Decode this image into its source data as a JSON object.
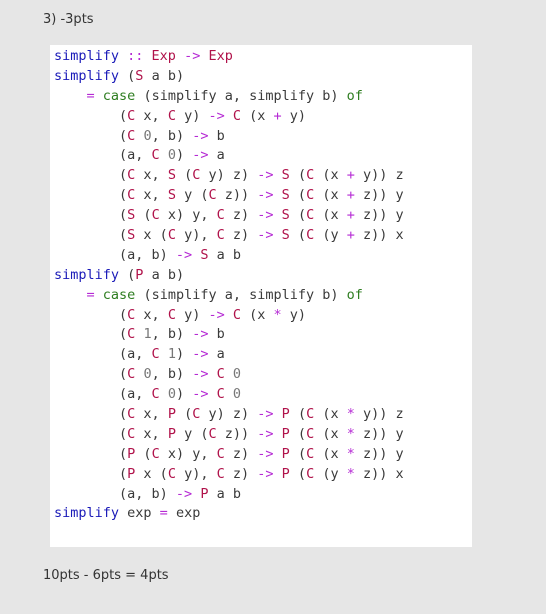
{
  "question_label": "3) -3pts",
  "score_text": "10pts - 6pts = 4pts",
  "colors": {
    "background": "#e6e6e6",
    "code_background": "#ffffff",
    "function_name": "#1a1ab8",
    "constructor": "#b0124a",
    "operator": "#b52ad4",
    "keyword": "#2e7d20",
    "number": "#777777",
    "plain": "#3a3a3a"
  },
  "code_lines": [
    [
      {
        "t": "simplify",
        "k": "kw"
      },
      {
        "t": " :: ",
        "k": "op"
      },
      {
        "t": "Exp",
        "k": "ty"
      },
      {
        "t": " -> ",
        "k": "op"
      },
      {
        "t": "Exp",
        "k": "ty"
      }
    ],
    [
      {
        "t": "simplify",
        "k": "kw"
      },
      {
        "t": " (",
        "k": "txt"
      },
      {
        "t": "S",
        "k": "ct"
      },
      {
        "t": " a b)",
        "k": "txt"
      }
    ],
    [
      {
        "t": "    ",
        "k": "txt"
      },
      {
        "t": "=",
        "k": "op"
      },
      {
        "t": " ",
        "k": "txt"
      },
      {
        "t": "case",
        "k": "kw2"
      },
      {
        "t": " (simplify a, simplify b) ",
        "k": "txt"
      },
      {
        "t": "of",
        "k": "kw2"
      }
    ],
    [
      {
        "t": "        (",
        "k": "txt"
      },
      {
        "t": "C",
        "k": "ct"
      },
      {
        "t": " x, ",
        "k": "txt"
      },
      {
        "t": "C",
        "k": "ct"
      },
      {
        "t": " y) ",
        "k": "txt"
      },
      {
        "t": "->",
        "k": "op"
      },
      {
        "t": " ",
        "k": "txt"
      },
      {
        "t": "C",
        "k": "ct"
      },
      {
        "t": " (x ",
        "k": "txt"
      },
      {
        "t": "+",
        "k": "op"
      },
      {
        "t": " y)",
        "k": "txt"
      }
    ],
    [
      {
        "t": "        (",
        "k": "txt"
      },
      {
        "t": "C",
        "k": "ct"
      },
      {
        "t": " ",
        "k": "txt"
      },
      {
        "t": "0",
        "k": "num"
      },
      {
        "t": ", b) ",
        "k": "txt"
      },
      {
        "t": "->",
        "k": "op"
      },
      {
        "t": " b",
        "k": "txt"
      }
    ],
    [
      {
        "t": "        (a, ",
        "k": "txt"
      },
      {
        "t": "C",
        "k": "ct"
      },
      {
        "t": " ",
        "k": "txt"
      },
      {
        "t": "0",
        "k": "num"
      },
      {
        "t": ") ",
        "k": "txt"
      },
      {
        "t": "->",
        "k": "op"
      },
      {
        "t": " a",
        "k": "txt"
      }
    ],
    [
      {
        "t": "        (",
        "k": "txt"
      },
      {
        "t": "C",
        "k": "ct"
      },
      {
        "t": " x, ",
        "k": "txt"
      },
      {
        "t": "S",
        "k": "ct"
      },
      {
        "t": " (",
        "k": "txt"
      },
      {
        "t": "C",
        "k": "ct"
      },
      {
        "t": " y) z) ",
        "k": "txt"
      },
      {
        "t": "->",
        "k": "op"
      },
      {
        "t": " ",
        "k": "txt"
      },
      {
        "t": "S",
        "k": "ct"
      },
      {
        "t": " (",
        "k": "txt"
      },
      {
        "t": "C",
        "k": "ct"
      },
      {
        "t": " (x ",
        "k": "txt"
      },
      {
        "t": "+",
        "k": "op"
      },
      {
        "t": " y)) z",
        "k": "txt"
      }
    ],
    [
      {
        "t": "        (",
        "k": "txt"
      },
      {
        "t": "C",
        "k": "ct"
      },
      {
        "t": " x, ",
        "k": "txt"
      },
      {
        "t": "S",
        "k": "ct"
      },
      {
        "t": " y (",
        "k": "txt"
      },
      {
        "t": "C",
        "k": "ct"
      },
      {
        "t": " z)) ",
        "k": "txt"
      },
      {
        "t": "->",
        "k": "op"
      },
      {
        "t": " ",
        "k": "txt"
      },
      {
        "t": "S",
        "k": "ct"
      },
      {
        "t": " (",
        "k": "txt"
      },
      {
        "t": "C",
        "k": "ct"
      },
      {
        "t": " (x ",
        "k": "txt"
      },
      {
        "t": "+",
        "k": "op"
      },
      {
        "t": " z)) y",
        "k": "txt"
      }
    ],
    [
      {
        "t": "        (",
        "k": "txt"
      },
      {
        "t": "S",
        "k": "ct"
      },
      {
        "t": " (",
        "k": "txt"
      },
      {
        "t": "C",
        "k": "ct"
      },
      {
        "t": " x) y, ",
        "k": "txt"
      },
      {
        "t": "C",
        "k": "ct"
      },
      {
        "t": " z) ",
        "k": "txt"
      },
      {
        "t": "->",
        "k": "op"
      },
      {
        "t": " ",
        "k": "txt"
      },
      {
        "t": "S",
        "k": "ct"
      },
      {
        "t": " (",
        "k": "txt"
      },
      {
        "t": "C",
        "k": "ct"
      },
      {
        "t": " (x ",
        "k": "txt"
      },
      {
        "t": "+",
        "k": "op"
      },
      {
        "t": " z)) y",
        "k": "txt"
      }
    ],
    [
      {
        "t": "        (",
        "k": "txt"
      },
      {
        "t": "S",
        "k": "ct"
      },
      {
        "t": " x (",
        "k": "txt"
      },
      {
        "t": "C",
        "k": "ct"
      },
      {
        "t": " y), ",
        "k": "txt"
      },
      {
        "t": "C",
        "k": "ct"
      },
      {
        "t": " z) ",
        "k": "txt"
      },
      {
        "t": "->",
        "k": "op"
      },
      {
        "t": " ",
        "k": "txt"
      },
      {
        "t": "S",
        "k": "ct"
      },
      {
        "t": " (",
        "k": "txt"
      },
      {
        "t": "C",
        "k": "ct"
      },
      {
        "t": " (y ",
        "k": "txt"
      },
      {
        "t": "+",
        "k": "op"
      },
      {
        "t": " z)) x",
        "k": "txt"
      }
    ],
    [
      {
        "t": "        (a, b) ",
        "k": "txt"
      },
      {
        "t": "->",
        "k": "op"
      },
      {
        "t": " ",
        "k": "txt"
      },
      {
        "t": "S",
        "k": "ct"
      },
      {
        "t": " a b",
        "k": "txt"
      }
    ],
    [
      {
        "t": "simplify",
        "k": "kw"
      },
      {
        "t": " (",
        "k": "txt"
      },
      {
        "t": "P",
        "k": "ct"
      },
      {
        "t": " a b)",
        "k": "txt"
      }
    ],
    [
      {
        "t": "    ",
        "k": "txt"
      },
      {
        "t": "=",
        "k": "op"
      },
      {
        "t": " ",
        "k": "txt"
      },
      {
        "t": "case",
        "k": "kw2"
      },
      {
        "t": " (simplify a, simplify b) ",
        "k": "txt"
      },
      {
        "t": "of",
        "k": "kw2"
      }
    ],
    [
      {
        "t": "        (",
        "k": "txt"
      },
      {
        "t": "C",
        "k": "ct"
      },
      {
        "t": " x, ",
        "k": "txt"
      },
      {
        "t": "C",
        "k": "ct"
      },
      {
        "t": " y) ",
        "k": "txt"
      },
      {
        "t": "->",
        "k": "op"
      },
      {
        "t": " ",
        "k": "txt"
      },
      {
        "t": "C",
        "k": "ct"
      },
      {
        "t": " (x ",
        "k": "txt"
      },
      {
        "t": "*",
        "k": "op"
      },
      {
        "t": " y)",
        "k": "txt"
      }
    ],
    [
      {
        "t": "        (",
        "k": "txt"
      },
      {
        "t": "C",
        "k": "ct"
      },
      {
        "t": " ",
        "k": "txt"
      },
      {
        "t": "1",
        "k": "num"
      },
      {
        "t": ", b) ",
        "k": "txt"
      },
      {
        "t": "->",
        "k": "op"
      },
      {
        "t": " b",
        "k": "txt"
      }
    ],
    [
      {
        "t": "        (a, ",
        "k": "txt"
      },
      {
        "t": "C",
        "k": "ct"
      },
      {
        "t": " ",
        "k": "txt"
      },
      {
        "t": "1",
        "k": "num"
      },
      {
        "t": ") ",
        "k": "txt"
      },
      {
        "t": "->",
        "k": "op"
      },
      {
        "t": " a",
        "k": "txt"
      }
    ],
    [
      {
        "t": "        (",
        "k": "txt"
      },
      {
        "t": "C",
        "k": "ct"
      },
      {
        "t": " ",
        "k": "txt"
      },
      {
        "t": "0",
        "k": "num"
      },
      {
        "t": ", b) ",
        "k": "txt"
      },
      {
        "t": "->",
        "k": "op"
      },
      {
        "t": " ",
        "k": "txt"
      },
      {
        "t": "C",
        "k": "ct"
      },
      {
        "t": " ",
        "k": "txt"
      },
      {
        "t": "0",
        "k": "num"
      }
    ],
    [
      {
        "t": "        (a, ",
        "k": "txt"
      },
      {
        "t": "C",
        "k": "ct"
      },
      {
        "t": " ",
        "k": "txt"
      },
      {
        "t": "0",
        "k": "num"
      },
      {
        "t": ") ",
        "k": "txt"
      },
      {
        "t": "->",
        "k": "op"
      },
      {
        "t": " ",
        "k": "txt"
      },
      {
        "t": "C",
        "k": "ct"
      },
      {
        "t": " ",
        "k": "txt"
      },
      {
        "t": "0",
        "k": "num"
      }
    ],
    [
      {
        "t": "        (",
        "k": "txt"
      },
      {
        "t": "C",
        "k": "ct"
      },
      {
        "t": " x, ",
        "k": "txt"
      },
      {
        "t": "P",
        "k": "ct"
      },
      {
        "t": " (",
        "k": "txt"
      },
      {
        "t": "C",
        "k": "ct"
      },
      {
        "t": " y) z) ",
        "k": "txt"
      },
      {
        "t": "->",
        "k": "op"
      },
      {
        "t": " ",
        "k": "txt"
      },
      {
        "t": "P",
        "k": "ct"
      },
      {
        "t": " (",
        "k": "txt"
      },
      {
        "t": "C",
        "k": "ct"
      },
      {
        "t": " (x ",
        "k": "txt"
      },
      {
        "t": "*",
        "k": "op"
      },
      {
        "t": " y)) z",
        "k": "txt"
      }
    ],
    [
      {
        "t": "        (",
        "k": "txt"
      },
      {
        "t": "C",
        "k": "ct"
      },
      {
        "t": " x, ",
        "k": "txt"
      },
      {
        "t": "P",
        "k": "ct"
      },
      {
        "t": " y (",
        "k": "txt"
      },
      {
        "t": "C",
        "k": "ct"
      },
      {
        "t": " z)) ",
        "k": "txt"
      },
      {
        "t": "->",
        "k": "op"
      },
      {
        "t": " ",
        "k": "txt"
      },
      {
        "t": "P",
        "k": "ct"
      },
      {
        "t": " (",
        "k": "txt"
      },
      {
        "t": "C",
        "k": "ct"
      },
      {
        "t": " (x ",
        "k": "txt"
      },
      {
        "t": "*",
        "k": "op"
      },
      {
        "t": " z)) y",
        "k": "txt"
      }
    ],
    [
      {
        "t": "        (",
        "k": "txt"
      },
      {
        "t": "P",
        "k": "ct"
      },
      {
        "t": " (",
        "k": "txt"
      },
      {
        "t": "C",
        "k": "ct"
      },
      {
        "t": " x) y, ",
        "k": "txt"
      },
      {
        "t": "C",
        "k": "ct"
      },
      {
        "t": " z) ",
        "k": "txt"
      },
      {
        "t": "->",
        "k": "op"
      },
      {
        "t": " ",
        "k": "txt"
      },
      {
        "t": "P",
        "k": "ct"
      },
      {
        "t": " (",
        "k": "txt"
      },
      {
        "t": "C",
        "k": "ct"
      },
      {
        "t": " (x ",
        "k": "txt"
      },
      {
        "t": "*",
        "k": "op"
      },
      {
        "t": " z)) y",
        "k": "txt"
      }
    ],
    [
      {
        "t": "        (",
        "k": "txt"
      },
      {
        "t": "P",
        "k": "ct"
      },
      {
        "t": " x (",
        "k": "txt"
      },
      {
        "t": "C",
        "k": "ct"
      },
      {
        "t": " y), ",
        "k": "txt"
      },
      {
        "t": "C",
        "k": "ct"
      },
      {
        "t": " z) ",
        "k": "txt"
      },
      {
        "t": "->",
        "k": "op"
      },
      {
        "t": " ",
        "k": "txt"
      },
      {
        "t": "P",
        "k": "ct"
      },
      {
        "t": " (",
        "k": "txt"
      },
      {
        "t": "C",
        "k": "ct"
      },
      {
        "t": " (y ",
        "k": "txt"
      },
      {
        "t": "*",
        "k": "op"
      },
      {
        "t": " z)) x",
        "k": "txt"
      }
    ],
    [
      {
        "t": "        (a, b) ",
        "k": "txt"
      },
      {
        "t": "->",
        "k": "op"
      },
      {
        "t": " ",
        "k": "txt"
      },
      {
        "t": "P",
        "k": "ct"
      },
      {
        "t": " a b",
        "k": "txt"
      }
    ],
    [
      {
        "t": "simplify",
        "k": "kw"
      },
      {
        "t": " exp ",
        "k": "txt"
      },
      {
        "t": "=",
        "k": "op"
      },
      {
        "t": " exp",
        "k": "txt"
      }
    ]
  ]
}
